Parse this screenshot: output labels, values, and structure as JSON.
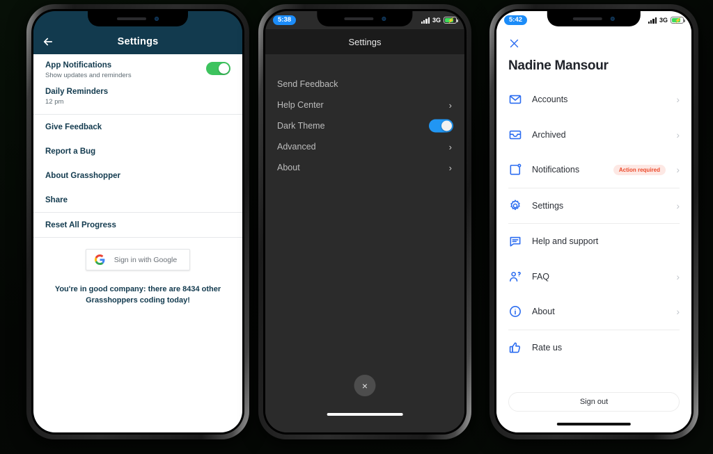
{
  "phone1": {
    "name": "grasshopper-settings",
    "statusbar": {
      "time": "",
      "network": "",
      "battery": ""
    },
    "header": {
      "back_icon": "arrow-left-icon",
      "title": "Settings"
    },
    "notifications": {
      "label": "App Notifications",
      "sublabel": "Show updates and reminders",
      "toggle_state": "on",
      "toggle_color": "#3dc35e"
    },
    "daily_reminders": {
      "label": "Daily Reminders",
      "value": "12 pm"
    },
    "menu": [
      {
        "label": "Give Feedback"
      },
      {
        "label": "Report a Bug"
      },
      {
        "label": "About Grasshopper"
      },
      {
        "label": "Share"
      }
    ],
    "reset": {
      "label": "Reset All Progress"
    },
    "signin": {
      "label": "Sign in with Google",
      "icon": "google-g-icon"
    },
    "message": "You're in good company: there are 8434 other Grasshoppers coding today!",
    "accent": "#123a4e"
  },
  "phone2": {
    "name": "dark-theme-settings",
    "statusbar": {
      "time": "5:38",
      "network": "3G",
      "battery": "charging"
    },
    "header": {
      "title": "Settings"
    },
    "rows": [
      {
        "label": "Send Feedback",
        "accessory": "none"
      },
      {
        "label": "Help Center",
        "accessory": "chevron"
      },
      {
        "label": "Dark Theme",
        "accessory": "toggle",
        "toggle_state": "on",
        "toggle_color": "#2196f3"
      },
      {
        "label": "Advanced",
        "accessory": "chevron"
      },
      {
        "label": "About",
        "accessory": "chevron"
      }
    ],
    "close_button": {
      "icon": "close-icon",
      "label": "×"
    },
    "chevron": "›"
  },
  "phone3": {
    "name": "account-panel",
    "statusbar": {
      "time": "5:42",
      "network": "3G",
      "battery": "charging"
    },
    "close_icon": "close-icon",
    "user_name": "Nadine Mansour",
    "items": [
      {
        "label": "Accounts",
        "icon": "envelope-icon",
        "chevron": true,
        "badge": ""
      },
      {
        "label": "Archived",
        "icon": "archive-box-icon",
        "chevron": true,
        "badge": ""
      },
      {
        "label": "Notifications",
        "icon": "bell-square-icon",
        "chevron": true,
        "badge": "Action required"
      },
      {
        "label": "Settings",
        "icon": "gear-icon",
        "chevron": true,
        "badge": ""
      },
      {
        "label": "Help and support",
        "icon": "chat-bubble-icon",
        "chevron": false,
        "badge": ""
      },
      {
        "label": "FAQ",
        "icon": "person-question-icon",
        "chevron": true,
        "badge": ""
      },
      {
        "label": "About",
        "icon": "info-circle-icon",
        "chevron": true,
        "badge": ""
      },
      {
        "label": "Rate us",
        "icon": "thumbs-up-icon",
        "chevron": false,
        "badge": ""
      }
    ],
    "sign_out": {
      "label": "Sign out"
    },
    "chevron": "›",
    "accent": "#2b6cf0",
    "badge_color": "#ec4a2b"
  }
}
